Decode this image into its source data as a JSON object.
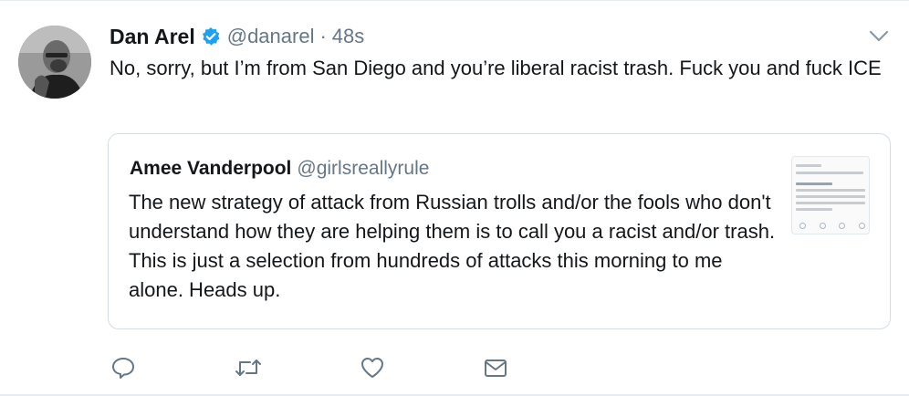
{
  "tweet": {
    "author_name": "Dan Arel",
    "verified": true,
    "handle": "@danarel",
    "separator": "·",
    "time": "48s",
    "text": "No, sorry, but I’m from San Diego and you’re liberal racist trash. Fuck you and fuck ICE"
  },
  "quoted_tweet": {
    "author_name": "Amee Vanderpool",
    "handle": "@girlsreallyrule",
    "text": "The new strategy of attack from Russian trolls and/or the fools who don't understand how they are helping them is to call you a racist and/or trash. This is just a selection from hundreds of attacks this morning to me alone. Heads up."
  },
  "icons": {
    "verified": "verified-badge-icon",
    "menu": "chevron-down-icon",
    "reply": "reply-icon",
    "retweet": "retweet-icon",
    "like": "heart-icon",
    "dm": "envelope-icon"
  },
  "colors": {
    "text": "#14171a",
    "secondary": "#657786",
    "verified": "#1da1f2",
    "border": "#e6ecf0"
  }
}
